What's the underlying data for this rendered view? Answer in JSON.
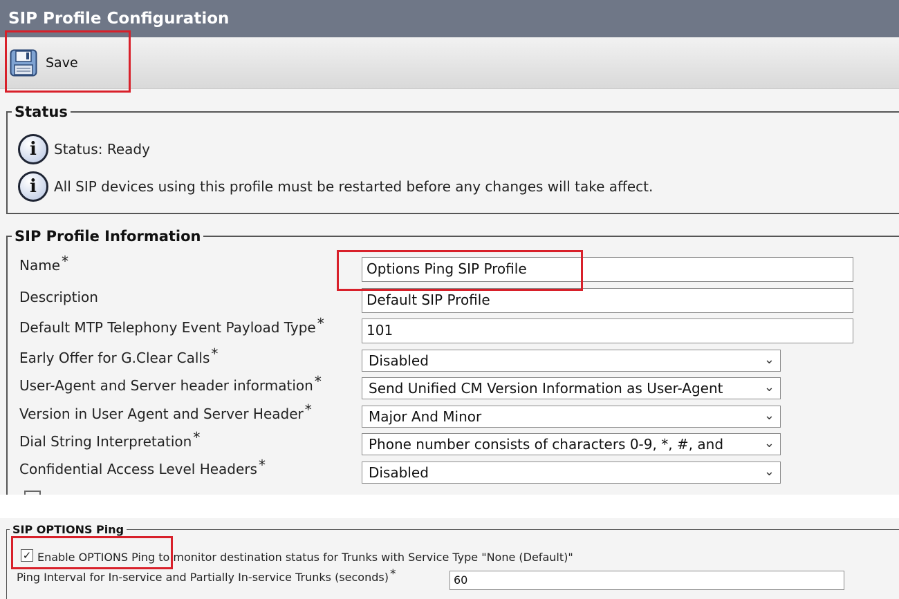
{
  "title": "SIP Profile Configuration",
  "toolbar": {
    "save_label": "Save",
    "save_icon": "floppy-disk-icon"
  },
  "status": {
    "legend": "Status",
    "messages": [
      "Status: Ready",
      "All SIP devices using this profile must be restarted before any changes will take affect."
    ]
  },
  "profile_info": {
    "legend": "SIP Profile Information",
    "name": {
      "label": "Name",
      "value": "Options Ping SIP Profile"
    },
    "description": {
      "label": "Description",
      "value": "Default SIP  Profile"
    },
    "mtp_payload": {
      "label": "Default MTP Telephony Event Payload Type",
      "value": "101"
    },
    "early_offer": {
      "label": "Early Offer for G.Clear Calls",
      "value": "Disabled"
    },
    "user_agent": {
      "label": "User-Agent and Server header information",
      "value": "Send Unified CM Version Information as User-Agent"
    },
    "version_header": {
      "label": "Version in User Agent and Server Header",
      "value": "Major And Minor"
    },
    "dial_string": {
      "label": "Dial String Interpretation",
      "value": "Phone number consists of characters 0-9, *, #, and"
    },
    "confidential": {
      "label": "Confidential Access Level Headers",
      "value": "Disabled"
    },
    "required_marker": "*"
  },
  "options_ping": {
    "legend": "SIP OPTIONS Ping",
    "enable_label": "Enable OPTIONS Ping to monitor destination status for Trunks with Service Type \"None (Default)\"",
    "enable_checked": true,
    "interval_label": "Ping Interval for In-service and Partially In-service Trunks (seconds)",
    "interval_value": "60"
  },
  "colors": {
    "title_bar": "#6f7787",
    "highlight": "#d8202a"
  }
}
